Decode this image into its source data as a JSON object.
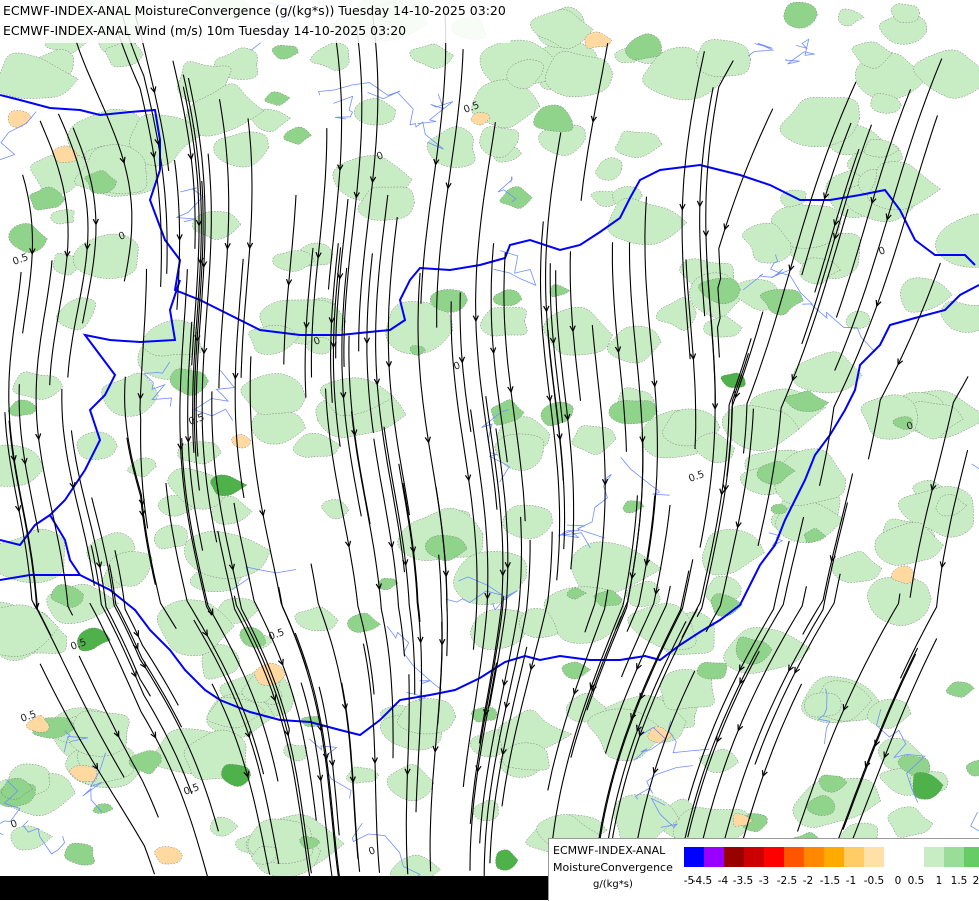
{
  "titles": {
    "line1": "ECMWF-INDEX-ANAL MoistureConvergence (g/(kg*s)) Tuesday 14-10-2025 03:20",
    "line2": "ECMWF-INDEX-ANAL Wind (m/s) 10m Tuesday 14-10-2025 03:20"
  },
  "legend": {
    "title1": "ECMWF-INDEX-ANAL",
    "title2": "MoistureConvergence",
    "unit": "g/(kg*s)",
    "colors": [
      "#0000ff",
      "#9900ff",
      "#990000",
      "#cc0000",
      "#ff0000",
      "#ff5500",
      "#ff8800",
      "#ffaa00",
      "#ffcc66",
      "#ffe0a8",
      "#ffffff",
      "#ffffff",
      "#c8ecc4",
      "#99dd99",
      "#66cc66",
      "#33aa33",
      "#009900"
    ],
    "ticks": [
      "-5",
      "-4.5",
      "-4",
      "-3.5",
      "-3",
      "-2.5",
      "-2",
      "-1.5",
      "-1",
      "-0.5",
      "0",
      "0.5",
      "1",
      "1.5",
      "2"
    ]
  },
  "contour_labels": [
    "0.5",
    "0",
    "0.5",
    "0.5",
    "0",
    "0.5",
    "0",
    "0",
    "0.5",
    "0",
    "0",
    "0.5",
    "0",
    "0.5",
    "0.5",
    "0"
  ],
  "colors": {
    "green_light": "#c8ecc4",
    "green_mid": "#8fd48a",
    "green_dark": "#4fb14a",
    "tan": "#ffd9a0",
    "border": "#0000ff",
    "river": "#6f8fff",
    "streamline": "#000000"
  }
}
